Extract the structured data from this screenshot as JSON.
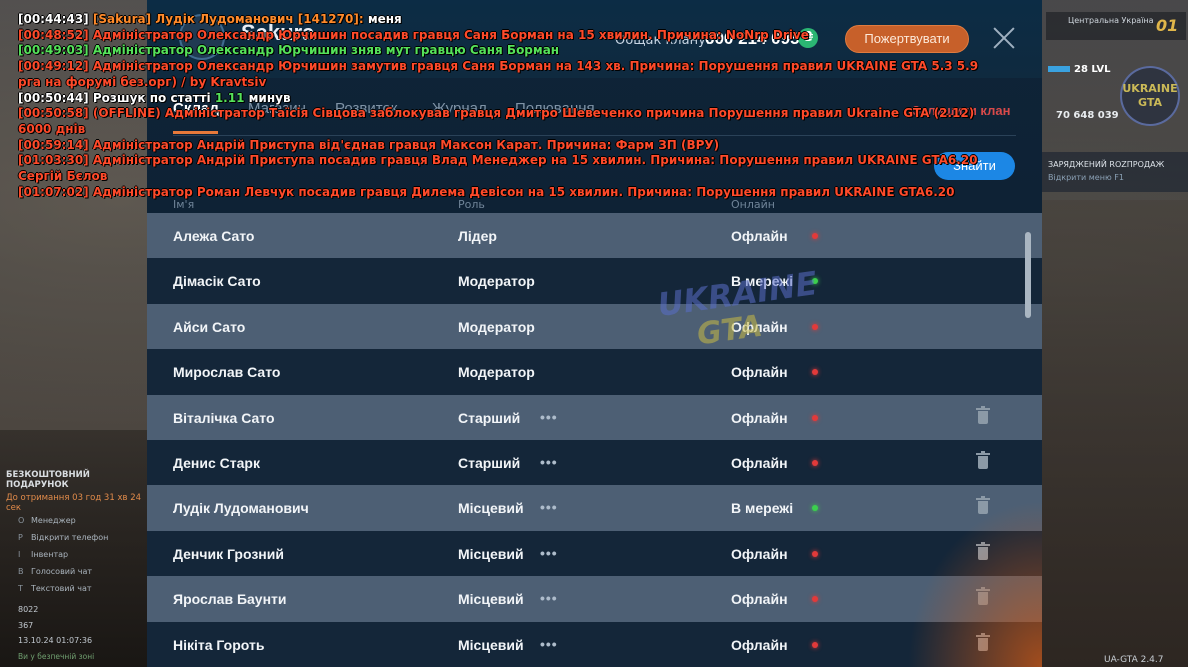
{
  "dialog": {
    "clan_name": "Sakura",
    "total_label": "Общак клану:",
    "total_value": "600 214 095",
    "coin_glyph": "₴",
    "donate_label": "Пожертвувати",
    "tabs": [
      {
        "label": "Склад"
      },
      {
        "label": "Магазин"
      },
      {
        "label": "Розвиток"
      },
      {
        "label": "Журнал"
      },
      {
        "label": "Полювання"
      }
    ],
    "leave_clan_label": "Залишити клан",
    "find_label": "Знайти",
    "columns": {
      "name": "Ім'я",
      "role": "Роль",
      "status": "Онлайн"
    },
    "members": [
      {
        "name": "Алежа Сато",
        "role": "Лідер",
        "status": "Офлайн",
        "online": false,
        "actions": false
      },
      {
        "name": "Дімасік Сато",
        "role": "Модератор",
        "status": "В мережі",
        "online": true,
        "actions": false
      },
      {
        "name": "Айси Сато",
        "role": "Модератор",
        "status": "Офлайн",
        "online": false,
        "actions": false
      },
      {
        "name": "Мирослав Сато",
        "role": "Модератор",
        "status": "Офлайн",
        "online": false,
        "actions": false
      },
      {
        "name": "Віталічка Сато",
        "role": "Старший",
        "status": "Офлайн",
        "online": false,
        "actions": true
      },
      {
        "name": "Денис Старк",
        "role": "Старший",
        "status": "Офлайн",
        "online": false,
        "actions": true
      },
      {
        "name": "Лудік Лудоманович",
        "role": "Місцевий",
        "status": "В мережі",
        "online": true,
        "actions": true
      },
      {
        "name": "Денчик Грозний",
        "role": "Місцевий",
        "status": "Офлайн",
        "online": false,
        "actions": true
      },
      {
        "name": "Ярослав Баунти",
        "role": "Місцевий",
        "status": "Офлайн",
        "online": false,
        "actions": true
      },
      {
        "name": "Нікіта Гороть",
        "role": "Місцевий",
        "status": "Офлайн",
        "online": false,
        "actions": true
      }
    ],
    "more_glyph": "•••",
    "colors": {
      "online": "#3ccf4e",
      "offline": "#e23a3a",
      "accent": "#e6793a",
      "primary": "#1c87e5"
    }
  },
  "watermark": {
    "top": "UKRAINE",
    "bottom": "GTA"
  },
  "chat": [
    {
      "parts": [
        {
          "t": "[00:44:43] ",
          "c": "white"
        },
        {
          "t": "[Sakura] Лудік Лудоманович [141270]:",
          "c": "orange"
        },
        {
          "t": " меня",
          "c": "white"
        }
      ]
    },
    {
      "parts": [
        {
          "t": "[00:48:52] Адміністратор Олександр Юрчишин посадив гравця Саня Борман на 15 хвилин. Причина: NoNrp Drive",
          "c": "red"
        }
      ]
    },
    {
      "parts": [
        {
          "t": "[00:49:03] Адміністратор Олександр Юрчишин зняв мут гравцю Саня Борман",
          "c": "green"
        }
      ]
    },
    {
      "parts": [
        {
          "t": "[00:49:12] Адміністратор Олександр Юрчишин замутив гравця Саня Борман на 143 хв. Причина: Порушення правил UKRAINE GTA 5.3 5.9",
          "c": "red"
        }
      ]
    },
    {
      "parts": [
        {
          "t": "рга на форумі без.орг) / by Kravtsiv",
          "c": "red"
        }
      ]
    },
    {
      "parts": [
        {
          "t": "[00:50:44] Розшук по статті ",
          "c": "white"
        },
        {
          "t": "1.11",
          "c": "green"
        },
        {
          "t": " минув",
          "c": "white"
        }
      ]
    },
    {
      "parts": [
        {
          "t": "[00:50:58] (OFFLINE) Адміністратор Таїсія Сівцова заблокував гравця Дмитро Шевеченко причина Порушення правил Ukraine GTA (2.12)",
          "c": "red"
        }
      ]
    },
    {
      "parts": [
        {
          "t": " 6000 днів",
          "c": "red"
        }
      ]
    },
    {
      "parts": [
        {
          "t": "[00:59:14] Адміністратор Андрій Приступа від'єднав гравця Максон Карат. Причина: Фарм ЗП (ВРУ)",
          "c": "red"
        }
      ]
    },
    {
      "parts": [
        {
          "t": "[01:03:30] Адміністратор Андрій Приступа посадив гравця Влад Менеджер на 15 хвилин. Причина: Порушення правил UKRAINE GTA6.20",
          "c": "red"
        }
      ]
    },
    {
      "parts": [
        {
          "t": " Сергій Бєлов",
          "c": "red"
        }
      ]
    },
    {
      "parts": [
        {
          "t": "[01:07:02] Адміністратор Роман Левчук посадив гравця Дилема Девісон на 15 хвилин. Причина: Порушення правил UKRAINE GTA6.20",
          "c": "red"
        }
      ]
    }
  ],
  "hud_right": {
    "region_name": "Центральна Україна",
    "region_number": "01",
    "level_text": "28 LVL",
    "money": "70 648 039",
    "logo_top": "UKRAINE",
    "logo_bottom": "GTA",
    "charge_title": "ЗАРЯДЖЕНИЙ ROZПРОДАЖ",
    "charge_sub": "Відкрити меню",
    "charge_key": "F1",
    "version": "UA-GTA 2.4.7"
  },
  "hud_left": {
    "gift_title": "БЕЗКОШТОВНИЙ ПОДАРУНОК",
    "gift_sub": "До отримання 03 год 31 хв 24 сек",
    "hotkeys": [
      {
        "key": "O",
        "label": "Менеджер"
      },
      {
        "key": "P",
        "label": "Відкрити телефон"
      },
      {
        "key": "I",
        "label": "Інвентар"
      },
      {
        "key": "B",
        "label": "Голосовий чат"
      },
      {
        "key": "T",
        "label": "Текстовий чат"
      }
    ],
    "id_value": "8022",
    "online_value": "367",
    "datetime": "13.10.24 01:07:36",
    "safe_zone": "Ви у безпечній зоні"
  }
}
